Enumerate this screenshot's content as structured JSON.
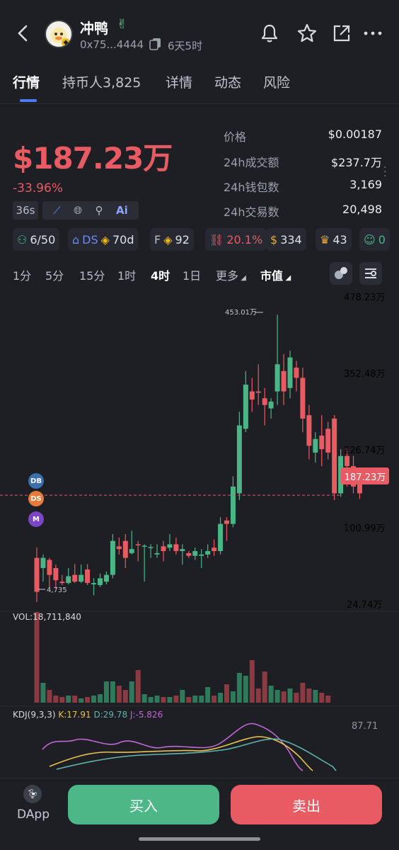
{
  "header": {
    "token_name": "冲鸭",
    "address": "0x75...4444",
    "age": "6天5时"
  },
  "tabs": [
    {
      "label": "行情",
      "active": true
    },
    {
      "label": "持币人3,825",
      "active": false
    },
    {
      "label": "详情",
      "active": false
    },
    {
      "label": "动态",
      "active": false
    },
    {
      "label": "风险",
      "active": false
    }
  ],
  "price": {
    "market_cap": "$187.23万",
    "change": "-33.96%",
    "refresh": "36s"
  },
  "stats": [
    {
      "label": "价格",
      "value": "$0.00187"
    },
    {
      "label": "24h成交额",
      "value": "$237.7万"
    },
    {
      "label": "24h钱包数",
      "value": "3,169"
    },
    {
      "label": "24h交易数",
      "value": "20,498"
    }
  ],
  "badges": {
    "holders_ratio": "6/50",
    "dev_label": "DS",
    "dev_age": "70d",
    "f_label": "F",
    "f_value": "92",
    "top_pct": "20.1%",
    "money": "334",
    "trophy": "43",
    "smile": "0"
  },
  "timeframes": {
    "items": [
      "1分",
      "5分",
      "15分",
      "1时",
      "4时",
      "1日",
      "更多",
      "市值"
    ],
    "active": "4时"
  },
  "chart": {
    "axis_labels": [
      "478.23万",
      "352.48万",
      "226.74万",
      "100.99万",
      "24.74万"
    ],
    "high_label": "453.01万",
    "low_label": "4,735",
    "current_label": "187.23万",
    "markers": [
      "DB",
      "DS",
      "M"
    ],
    "volume_label": "VOL:18,711,840",
    "kdj": {
      "title": "KDJ(9,3,3)",
      "k": "K:17.91",
      "d": "D:29.78",
      "j": "J:-5.826",
      "max": "87.71"
    }
  },
  "chart_data": {
    "type": "candlestick",
    "ylim": [
      24.74,
      478.23
    ],
    "current": 187.23,
    "high_marker": 453.01,
    "candles": [
      {
        "o": 95,
        "c": 45,
        "h": 110,
        "l": 30
      },
      {
        "o": 80,
        "c": 95,
        "h": 100,
        "l": 60
      },
      {
        "o": 92,
        "c": 70,
        "h": 95,
        "l": 50
      },
      {
        "o": 80,
        "c": 62,
        "h": 85,
        "l": 50
      },
      {
        "o": 60,
        "c": 58,
        "h": 70,
        "l": 55
      },
      {
        "o": 58,
        "c": 68,
        "h": 80,
        "l": 56
      },
      {
        "o": 70,
        "c": 60,
        "h": 86,
        "l": 58
      },
      {
        "o": 60,
        "c": 70,
        "h": 85,
        "l": 58
      },
      {
        "o": 78,
        "c": 58,
        "h": 86,
        "l": 55
      },
      {
        "o": 56,
        "c": 58,
        "h": 65,
        "l": 40
      },
      {
        "o": 55,
        "c": 65,
        "h": 72,
        "l": 52
      },
      {
        "o": 60,
        "c": 70,
        "h": 75,
        "l": 56
      },
      {
        "o": 70,
        "c": 120,
        "h": 130,
        "l": 65
      },
      {
        "o": 112,
        "c": 108,
        "h": 125,
        "l": 100
      },
      {
        "o": 120,
        "c": 95,
        "h": 130,
        "l": 80
      },
      {
        "o": 102,
        "c": 108,
        "h": 135,
        "l": 100
      },
      {
        "o": 115,
        "c": 114,
        "h": 120,
        "l": 90
      },
      {
        "o": 112,
        "c": 113,
        "h": 115,
        "l": 60
      },
      {
        "o": 110,
        "c": 111,
        "h": 115,
        "l": 95
      },
      {
        "o": 100,
        "c": 102,
        "h": 115,
        "l": 95
      },
      {
        "o": 112,
        "c": 105,
        "h": 120,
        "l": 90
      },
      {
        "o": 110,
        "c": 115,
        "h": 130,
        "l": 105
      },
      {
        "o": 115,
        "c": 105,
        "h": 125,
        "l": 100
      },
      {
        "o": 105,
        "c": 108,
        "h": 115,
        "l": 85
      },
      {
        "o": 102,
        "c": 98,
        "h": 105,
        "l": 95
      },
      {
        "o": 98,
        "c": 105,
        "h": 110,
        "l": 92
      },
      {
        "o": 98,
        "c": 100,
        "h": 108,
        "l": 80
      },
      {
        "o": 100,
        "c": 105,
        "h": 115,
        "l": 95
      },
      {
        "o": 110,
        "c": 105,
        "h": 122,
        "l": 98
      },
      {
        "o": 105,
        "c": 145,
        "h": 155,
        "l": 100
      },
      {
        "o": 150,
        "c": 145,
        "h": 155,
        "l": 120
      },
      {
        "o": 145,
        "c": 200,
        "h": 215,
        "l": 140
      },
      {
        "o": 190,
        "c": 290,
        "h": 310,
        "l": 180
      },
      {
        "o": 285,
        "c": 350,
        "h": 370,
        "l": 280
      },
      {
        "o": 340,
        "c": 328,
        "h": 360,
        "l": 310
      },
      {
        "o": 340,
        "c": 338,
        "h": 380,
        "l": 320
      },
      {
        "o": 330,
        "c": 320,
        "h": 345,
        "l": 290
      },
      {
        "o": 315,
        "c": 325,
        "h": 330,
        "l": 300
      },
      {
        "o": 340,
        "c": 380,
        "h": 453,
        "l": 320
      },
      {
        "o": 370,
        "c": 340,
        "h": 395,
        "l": 320
      },
      {
        "o": 345,
        "c": 390,
        "h": 400,
        "l": 330
      },
      {
        "o": 375,
        "c": 360,
        "h": 385,
        "l": 340
      },
      {
        "o": 360,
        "c": 300,
        "h": 375,
        "l": 280
      },
      {
        "o": 305,
        "c": 260,
        "h": 320,
        "l": 240
      },
      {
        "o": 250,
        "c": 270,
        "h": 280,
        "l": 235
      },
      {
        "o": 275,
        "c": 255,
        "h": 305,
        "l": 230
      },
      {
        "o": 285,
        "c": 250,
        "h": 295,
        "l": 240
      },
      {
        "o": 300,
        "c": 190,
        "h": 305,
        "l": 180
      },
      {
        "o": 190,
        "c": 245,
        "h": 255,
        "l": 185
      },
      {
        "o": 245,
        "c": 230,
        "h": 255,
        "l": 200
      },
      {
        "o": 230,
        "c": 200,
        "h": 245,
        "l": 190
      },
      {
        "o": 205,
        "c": 190,
        "h": 215,
        "l": 182
      }
    ],
    "volume": [
      128,
      28,
      18,
      10,
      8,
      10,
      10,
      6,
      8,
      10,
      12,
      30,
      30,
      24,
      18,
      30,
      46,
      12,
      8,
      10,
      8,
      8,
      10,
      18,
      8,
      10,
      10,
      22,
      10,
      14,
      26,
      16,
      42,
      38,
      60,
      20,
      44,
      24,
      18,
      16,
      20,
      14,
      28,
      20,
      18,
      14,
      10
    ]
  },
  "bottom": {
    "dapp": "DApp",
    "buy": "买入",
    "sell": "卖出"
  },
  "colors": {
    "up": "#4bb586",
    "down": "#e85b63",
    "accent": "#4e7cf6",
    "bg": "#1d1f25"
  }
}
